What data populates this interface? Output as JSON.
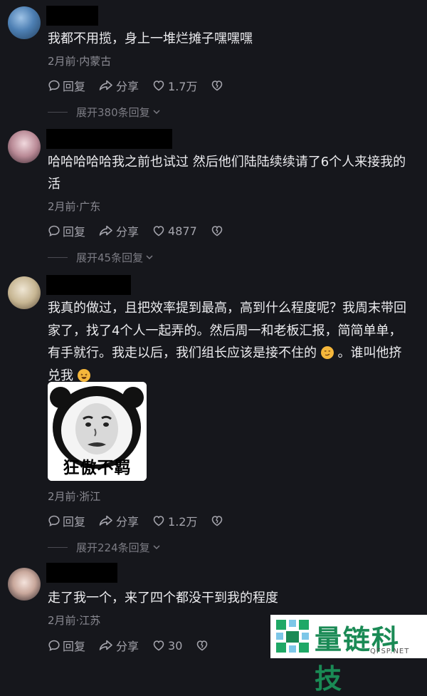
{
  "comments": [
    {
      "text": "我都不用揽，身上一堆烂摊子嘿嘿嘿",
      "meta": "2月前·内蒙古",
      "reply_label": "回复",
      "share_label": "分享",
      "likes": "1.7万",
      "more_replies": "展开380条回复"
    },
    {
      "text": "哈哈哈哈哈我之前也试过 然后他们陆陆续续请了6个人来接我的活",
      "meta": "2月前·广东",
      "reply_label": "回复",
      "share_label": "分享",
      "likes": "4877",
      "more_replies": "展开45条回复"
    },
    {
      "text_before": "我真的做过，且把效率提到最高，高到什么程度呢？我周末带回家了，找了4个人一起弄的。然后周一和老板汇报，简简单单，有手就行。我走以后，我们组长应该是接不住的",
      "text_middle": "。谁叫他挤兑我",
      "sticker_caption": "狂傲不羁",
      "meta": "2月前·浙江",
      "reply_label": "回复",
      "share_label": "分享",
      "likes": "1.2万",
      "more_replies": "展开224条回复"
    },
    {
      "text": "走了我一个，来了四个都没干到我的程度",
      "meta": "2月前·江苏",
      "reply_label": "回复",
      "share_label": "分享",
      "likes": "30"
    }
  ],
  "watermark": {
    "text": "量链科技",
    "sub": "QFSP.NET"
  },
  "colors": {
    "background": "#16171c",
    "text": "#ececef",
    "meta": "#8b8b93",
    "watermark_green": "#1a8a55"
  }
}
